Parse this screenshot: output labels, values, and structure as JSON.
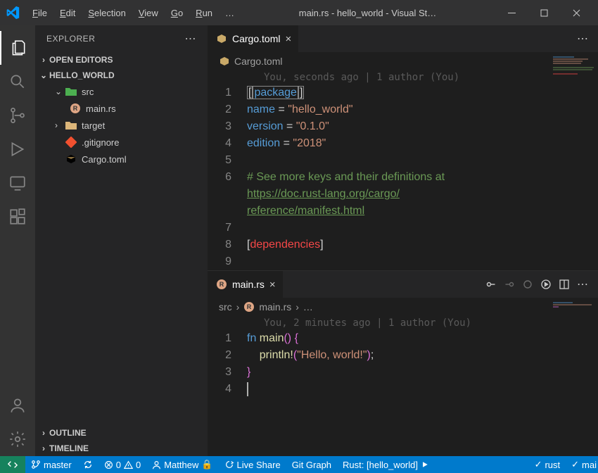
{
  "titlebar": {
    "title": "main.rs - hello_world - Visual St…",
    "menu": [
      "File",
      "Edit",
      "Selection",
      "View",
      "Go",
      "Run",
      "…"
    ]
  },
  "sidebar": {
    "title": "EXPLORER",
    "sections": {
      "openEditors": "OPEN EDITORS",
      "outline": "OUTLINE",
      "timeline": "TIMELINE"
    },
    "project": "HELLO_WORLD",
    "tree": {
      "src": "src",
      "mainrs": "main.rs",
      "target": "target",
      "gitignore": ".gitignore",
      "cargotoml": "Cargo.toml"
    }
  },
  "tabs": {
    "top": "Cargo.toml",
    "bottom": "main.rs"
  },
  "crumbTop": "Cargo.toml",
  "crumbBottom": {
    "dir": "src",
    "file": "main.rs",
    "tail": "…"
  },
  "blameTop": "You, seconds ago | 1 author (You)",
  "blameBottom": "You, 2 minutes ago | 1 author (You)",
  "cargo": {
    "l1a": "[",
    "l1b": "package",
    "l1c": "]",
    "l2a": "name",
    "l2b": " = ",
    "l2c": "\"hello_world\"",
    "l3a": "version",
    "l3b": " = ",
    "l3c": "\"0.1.0\"",
    "l4a": "edition",
    "l4b": " = ",
    "l4c": "\"2018\"",
    "l6": "# See more keys and their definitions at ",
    "l6link1": "https://doc.rust-lang.org/cargo/",
    "l6link2": "reference/manifest.html",
    "l8a": "[",
    "l8b": "dependencies",
    "l8c": "]"
  },
  "mainrs": {
    "l1a": "fn",
    "l1b": " main",
    "l1c": "()",
    " l1d": " {",
    "l2a": "    println!",
    "l2b": "(",
    "l2c": "\"Hello, world!\"",
    "l2d": ")",
    "l2e": ";",
    "l3": "}"
  },
  "status": {
    "branch": "master",
    "sync": "",
    "errors": "0",
    "warnings": "0",
    "user": "Matthew",
    "liveshare": "Live Share",
    "gitgraph": "Git Graph",
    "rust": "Rust: [hello_world]",
    "lang": "rust",
    "tail": "mai"
  },
  "lineNums": {
    "n1": "1",
    "n2": "2",
    "n3": "3",
    "n4": "4",
    "n5": "5",
    "n6": "6",
    "n7": "7",
    "n8": "8",
    "n9": "9"
  }
}
